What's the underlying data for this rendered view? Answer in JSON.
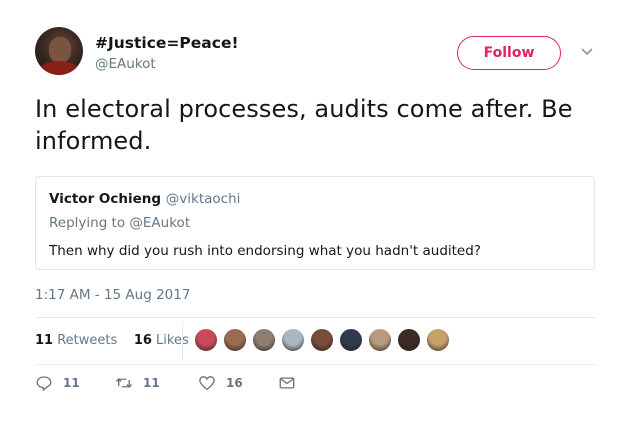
{
  "tweet": {
    "author_name": "#Justice=Peace!",
    "author_handle": "@EAukot",
    "follow_label": "Follow",
    "text": "In electoral processes, audits come after. Be informed.",
    "timestamp": "1:17 AM - 15 Aug 2017"
  },
  "quoted": {
    "name": "Victor Ochieng",
    "handle": "@viktaochi",
    "replying_to": "Replying to @EAukot",
    "text": "Then why did you rush into endorsing what you hadn't audited?"
  },
  "stats": {
    "retweets_count": "11",
    "retweets_label": "Retweets",
    "likes_count": "16",
    "likes_label": "Likes"
  },
  "actions": {
    "replies": "11",
    "retweets": "11",
    "likes": "16"
  },
  "colors": {
    "accent": "#e0245e",
    "muted": "#657786",
    "text": "#14171a",
    "border": "#e1e8ed"
  },
  "likers": [
    "#c94a5a",
    "#9a6b52",
    "#8e7f72",
    "#a9b8c4",
    "#7a4a3a",
    "#2f3b4a",
    "#b89a7e",
    "#3a2c25",
    "#c8a06a"
  ]
}
